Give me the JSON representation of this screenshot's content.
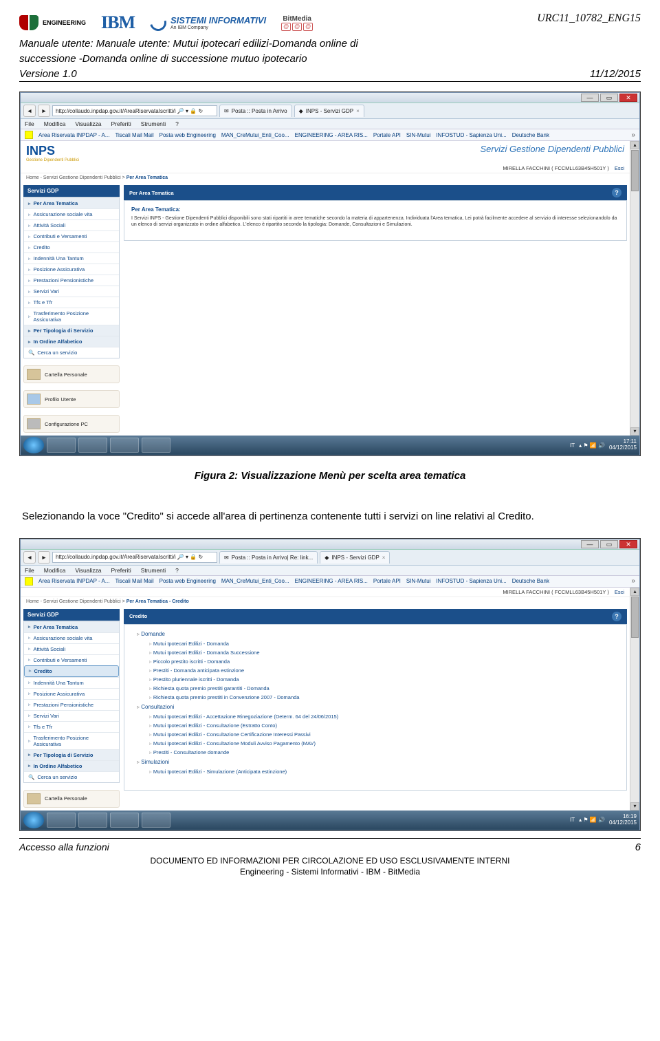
{
  "header": {
    "doc_id": "URC11_10782_ENG15",
    "title_line1": "Manuale utente: Manuale utente: Mutui ipotecari edilizi-Domanda online di",
    "title_line2": "successione -Domanda online di successione mutuo ipotecario",
    "version": "Versione 1.0",
    "date": "11/12/2015",
    "logos": {
      "eng": "ENGINEERING",
      "ibm": "IBM",
      "si_main": "SISTEMI INFORMATIVI",
      "si_sub": "An IBM Company",
      "bm_top": "BitMedia",
      "bm_a": "@"
    }
  },
  "screenshot1": {
    "url": "http://collaudo.inpdap.gov.it/AreaRiservataIscritti/i",
    "tabs": [
      {
        "icon": "mail",
        "label": "Posta :: Posta in Arrivo"
      },
      {
        "icon": "inps",
        "label": "INPS - Servizi GDP",
        "close": "×"
      }
    ],
    "menubar": [
      "File",
      "Modifica",
      "Visualizza",
      "Preferiti",
      "Strumenti",
      "?"
    ],
    "bookmarks": [
      "Area Riservata INPDAP - A...",
      "Tiscali Mail  Mail",
      "Posta  web Engineering",
      "MAN_CreMutui_Enti_Coo...",
      "ENGINEERING - AREA RIS...",
      "Portale API",
      "SIN-Mutui",
      "INFOSTUD - Sapienza Uni...",
      "Deutsche Bank"
    ],
    "inps_service": "Servizi Gestione Dipendenti Pubblici",
    "user": "MIRELLA FACCHINI ( FCCMLL63B45H501Y )",
    "esci": "Esci",
    "breadcrumb": "Home - Servizi Gestione Dipendenti Pubblici",
    "breadcrumb_active": "Per Area Tematica",
    "side_header": "Servizi GDP",
    "side_top": "Per Area Tematica",
    "side_items": [
      "Assicurazione sociale vita",
      "Attività Sociali",
      "Contributi e Versamenti",
      "Credito",
      "Indennità Una Tantum",
      "Posizione Assicurativa",
      "Prestazioni Pensionistiche",
      "Servizi Vari",
      "Tfs e Tfr",
      "Trasferimento Posizione Assicurativa"
    ],
    "side_bottom": [
      "Per Tipologia di Servizio",
      "In Ordine Alfabetico"
    ],
    "side_search": "Cerca un servizio",
    "side_extra": [
      "Cartella Personale",
      "Profilo Utente",
      "Configurazione PC"
    ],
    "main_header": "Per Area Tematica",
    "main_subheader": "Per Area Tematica:",
    "main_body": "I Servizi INPS - Gestione Dipendenti Pubblici disponibili sono stati ripartiti in aree tematiche secondo la materia di appartenenza.\nIndividuata l'Area tematica, Lei potrà facilmente accedere al servizio di interesse selezionandolo da un elenco di servizi organizzato in ordine alfabetico.\nL'elenco è ripartito secondo la tipologia: Domande, Consultazioni e Simulazioni.",
    "taskbar_lang": "IT",
    "taskbar_time": "17:11",
    "taskbar_date": "04/12/2015"
  },
  "caption1": "Figura 2: Visualizzazione Menù per scelta area tematica",
  "paragraph": "Selezionando la voce \"Credito\" si accede all'area di pertinenza contenente tutti i servizi on line relativi al Credito.",
  "screenshot2": {
    "url": "http://collaudo.inpdap.gov.it/AreaRiservataIscritti/i",
    "tabs": [
      {
        "icon": "mail",
        "label": "Posta :: Posta in Arrivo| Re: link..."
      },
      {
        "icon": "inps",
        "label": "INPS - Servizi GDP",
        "close": "×"
      }
    ],
    "menubar": [
      "File",
      "Modifica",
      "Visualizza",
      "Preferiti",
      "Strumenti",
      "?"
    ],
    "bookmarks": [
      "Area Riservata INPDAP - A...",
      "Tiscali Mail  Mail",
      "Posta  web Engineering",
      "MAN_CreMutui_Enti_Coo...",
      "ENGINEERING - AREA RIS...",
      "Portale API",
      "SIN-Mutui",
      "INFOSTUD - Sapienza Uni...",
      "Deutsche Bank"
    ],
    "user": "MIRELLA FACCHINI ( FCCMLL63B45H501Y )",
    "esci": "Esci",
    "breadcrumb": "Home - Servizi Gestione Dipendenti Pubblici",
    "breadcrumb_active": "Per Area Tematica - Credito",
    "side_header": "Servizi GDP",
    "side_top": "Per Area Tematica",
    "side_items": [
      "Assicurazione sociale vita",
      "Attività Sociali",
      "Contributi e Versamenti",
      "Credito",
      "Indennità Una Tantum",
      "Posizione Assicurativa",
      "Prestazioni Pensionistiche",
      "Servizi Vari",
      "Tfs e Tfr",
      "Trasferimento Posizione Assicurativa"
    ],
    "side_bottom": [
      "Per Tipologia di Servizio",
      "In Ordine Alfabetico"
    ],
    "side_search": "Cerca un servizio",
    "side_extra": [
      "Cartella Personale"
    ],
    "main_header": "Credito",
    "tree": [
      {
        "lvl": 0,
        "label": "Domande"
      },
      {
        "lvl": 1,
        "label": "Mutui Ipotecari Edilizi - Domanda"
      },
      {
        "lvl": 1,
        "label": "Mutui Ipotecari Edilizi - Domanda Successione"
      },
      {
        "lvl": 1,
        "label": "Piccolo prestito iscritti - Domanda"
      },
      {
        "lvl": 1,
        "label": "Prestiti - Domanda anticipata estinzione"
      },
      {
        "lvl": 1,
        "label": "Prestito pluriennale iscritti - Domanda"
      },
      {
        "lvl": 1,
        "label": "Richiesta quota premio prestiti garantiti - Domanda"
      },
      {
        "lvl": 1,
        "label": "Richiesta quota premio prestiti in Convenzione 2007 - Domanda"
      },
      {
        "lvl": 0,
        "label": "Consultazioni"
      },
      {
        "lvl": 1,
        "label": "Mutui Ipotecari Edilizi - Accettazione Rinegoziazione (Determ. 64 del 24/06/2015)"
      },
      {
        "lvl": 1,
        "label": "Mutui Ipotecari Edilizi - Consultazione (Estratto Conto)"
      },
      {
        "lvl": 1,
        "label": "Mutui Ipotecari Edilizi - Consultazione Certificazione Interessi Passivi"
      },
      {
        "lvl": 1,
        "label": "Mutui Ipotecari Edilizi - Consultazione Moduli Avviso Pagamento (MAV)"
      },
      {
        "lvl": 1,
        "label": "Prestiti - Consultazione domande"
      },
      {
        "lvl": 0,
        "label": "Simulazioni"
      },
      {
        "lvl": 1,
        "label": "Mutui Ipotecari Edilizi - Simulazione (Anticipata estinzione)"
      }
    ],
    "taskbar_lang": "IT",
    "taskbar_time": "16:19",
    "taskbar_date": "04/12/2015"
  },
  "footer": {
    "section": "Accesso alla funzioni",
    "page": "6",
    "disclaimer": "DOCUMENTO ED INFORMAZIONI PER CIRCOLAZIONE ED USO ESCLUSIVAMENTE INTERNI",
    "companies": "Engineering - Sistemi Informativi - IBM - BitMedia"
  }
}
